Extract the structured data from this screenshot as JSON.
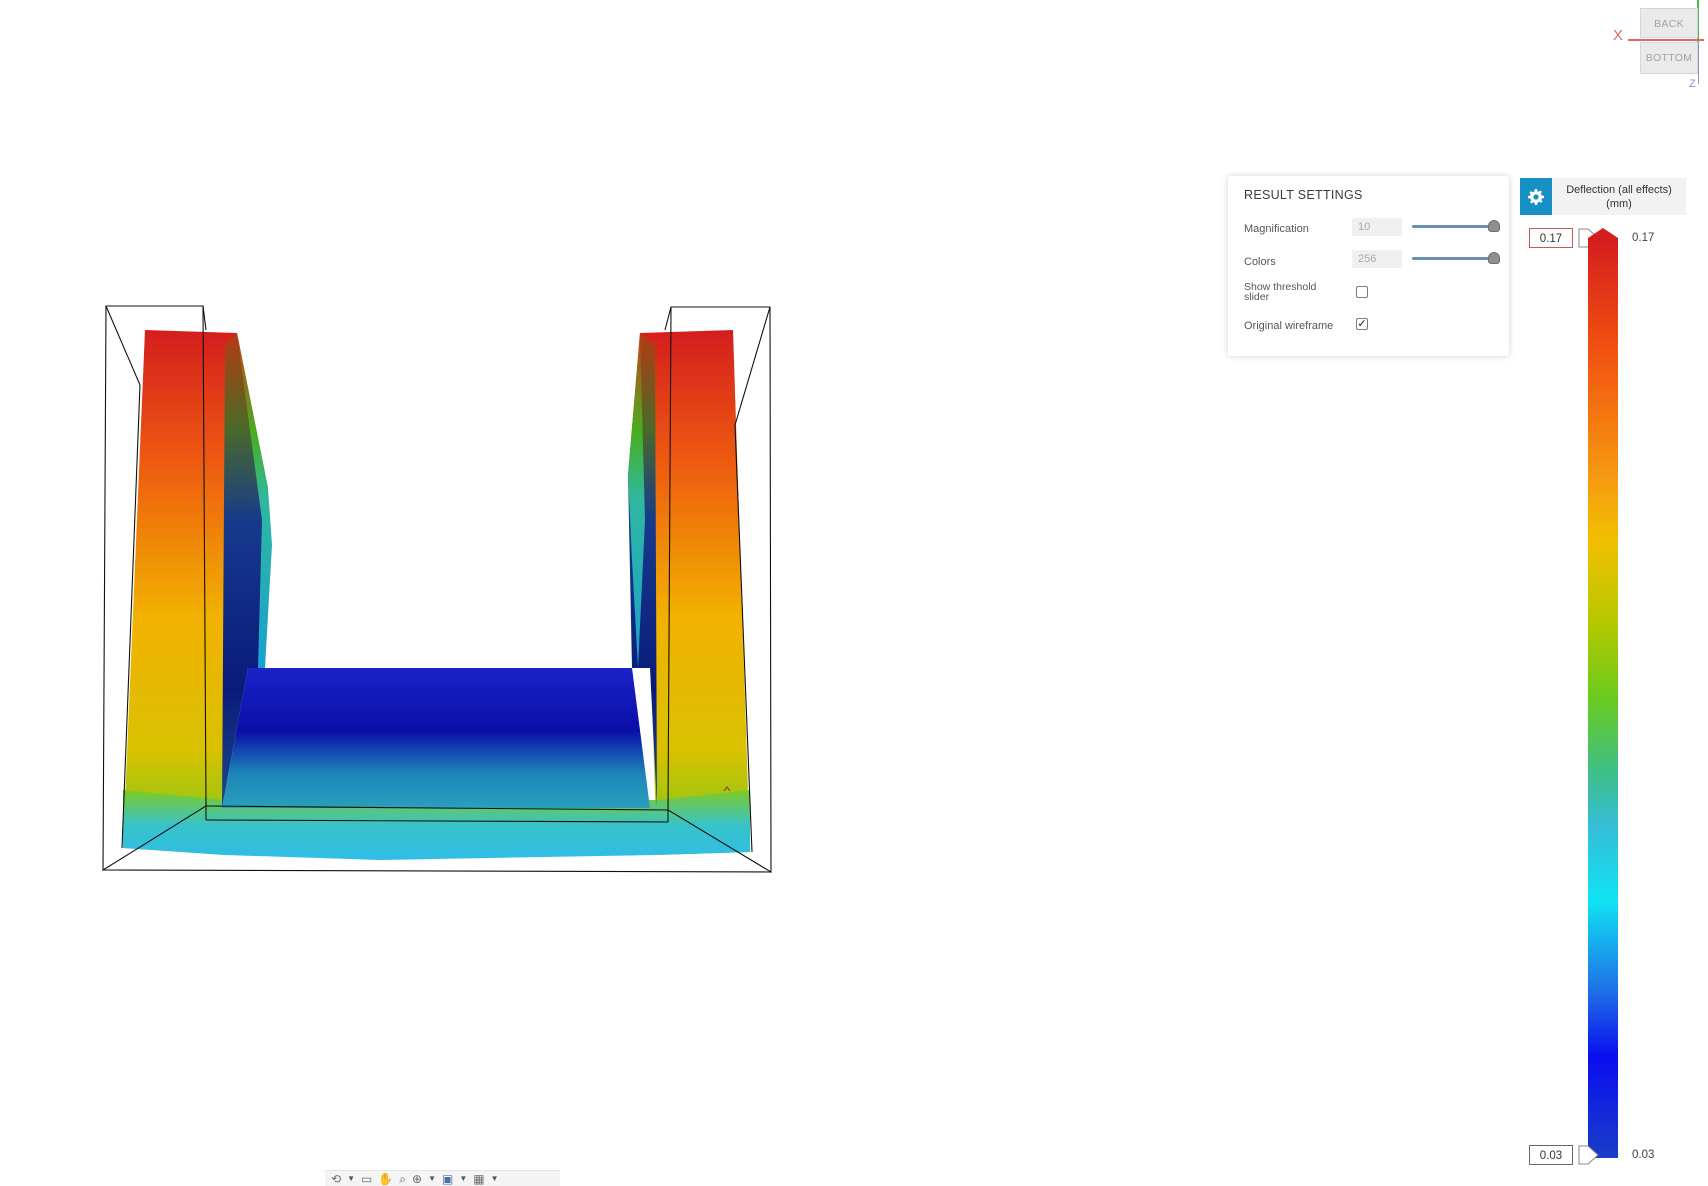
{
  "view_cube": {
    "face_top": "BACK",
    "face_front": "BOTTOM",
    "axis_x_label": "X",
    "axis_z_label": "Z"
  },
  "result_settings": {
    "title": "RESULT SETTINGS",
    "magnification": {
      "label": "Magnification",
      "value": "10",
      "slider_fraction": 1.0
    },
    "colors": {
      "label": "Colors",
      "value": "256",
      "slider_fraction": 1.0
    },
    "show_threshold_slider": {
      "label_line1": "Show threshold",
      "label_line2": "slider",
      "checked": false
    },
    "original_wireframe": {
      "label": "Original wireframe",
      "checked": true,
      "check_glyph": "✓"
    }
  },
  "legend": {
    "settings_icon": "gear-icon",
    "title_line1": "Deflection (all effects)",
    "title_line2": "(mm)",
    "max_input": "0.17",
    "min_input": "0.03",
    "max_label": "0.17",
    "min_label": "0.03",
    "colors": [
      "#d41d1d",
      "#f25011",
      "#f2c000",
      "#6acb1e",
      "#35bdd8",
      "#10e3f4",
      "#0a0ef0"
    ]
  },
  "nav_toolbar": {
    "icons": [
      "orbit-icon",
      "pan-hand-icon",
      "zoom-icon",
      "zoom-window-icon",
      "display-mode-icon",
      "grid-icon"
    ]
  }
}
